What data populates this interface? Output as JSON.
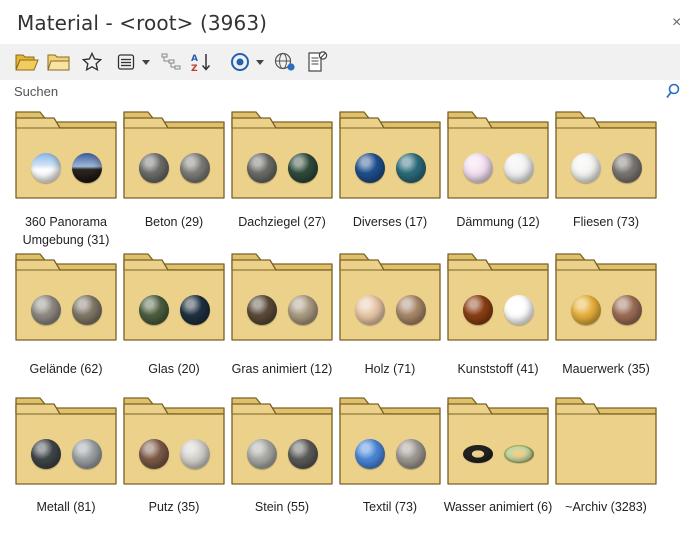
{
  "window": {
    "title": "Material - <root> (3963)"
  },
  "toolbar": {
    "items": [
      "open-folder-icon",
      "folder-icon",
      "star-icon",
      "list-view-icon",
      "dropdown-icon",
      "tree-icon",
      "sort-az-icon",
      "target-icon",
      "dropdown-icon",
      "globe-icon",
      "file-settings-icon"
    ]
  },
  "search": {
    "placeholder": "Suchen",
    "value": ""
  },
  "folders": [
    {
      "label": "360 Panorama Umgebung (31)",
      "spheres": [
        "sky-white",
        "sky-night"
      ]
    },
    {
      "label": "Beton (29)",
      "spheres": [
        "#6b6b68",
        "#7c7b77"
      ]
    },
    {
      "label": "Dachziegel (27)",
      "spheres": [
        "#6a6a66",
        "#2f4a3a"
      ]
    },
    {
      "label": "Diverses (17)",
      "spheres": [
        "#1f4f8c",
        "#2b6b7a"
      ]
    },
    {
      "label": "Dämmung (12)",
      "spheres": [
        "#f3dff0",
        "#f2f2f2"
      ]
    },
    {
      "label": "Fliesen (73)",
      "spheres": [
        "#f4f4f2",
        "#7a7672"
      ]
    },
    {
      "label": "Gelände (62)",
      "spheres": [
        "#8e8a82",
        "#807768"
      ]
    },
    {
      "label": "Glas (20)",
      "spheres": [
        "#4c5e3e",
        "#1e3040"
      ]
    },
    {
      "label": "Gras animiert (12)",
      "spheres": [
        "#5a4a38",
        "#a99a82"
      ]
    },
    {
      "label": "Holz (71)",
      "spheres": [
        "#e8c7a8",
        "#a78768"
      ]
    },
    {
      "label": "Kunststoff (41)",
      "spheres": [
        "#8a3e14",
        "#ffffff"
      ]
    },
    {
      "label": "Mauerwerk (35)",
      "spheres": [
        "#e7b13c",
        "#9b6d56"
      ]
    },
    {
      "label": "Metall (81)",
      "spheres": [
        "#3f4548",
        "#9aa0a3"
      ]
    },
    {
      "label": "Putz (35)",
      "spheres": [
        "#7b5a47",
        "#d3d1cb"
      ]
    },
    {
      "label": "Stein (55)",
      "spheres": [
        "#a8a8a4",
        "#5a5a58"
      ]
    },
    {
      "label": "Textil (73)",
      "spheres": [
        "#4a86d8",
        "#9d9790"
      ]
    },
    {
      "label": "Wasser animiert (6)",
      "spheres": [
        "torus-dark",
        "torus-light"
      ]
    },
    {
      "label": "~Archiv (3283)",
      "spheres": []
    }
  ]
}
